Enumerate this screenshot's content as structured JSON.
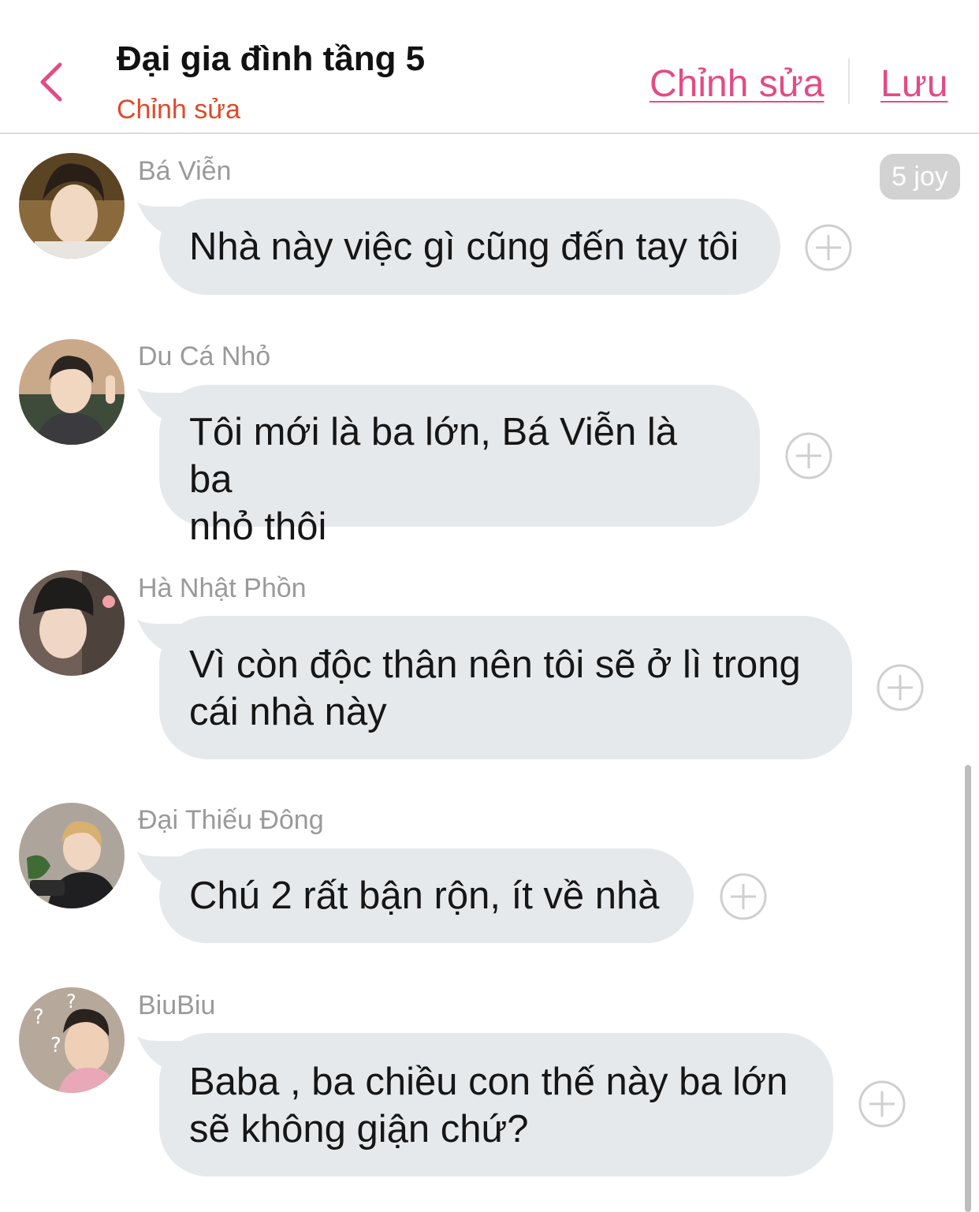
{
  "header": {
    "title": "Đại gia đình tầng 5",
    "subtitle": "Chỉnh sửa",
    "edit_label": "Chỉnh sửa",
    "save_label": "Lưu"
  },
  "badge": "5 joy",
  "messages": [
    {
      "sender": "Bá Viễn",
      "lines": [
        "Nhà này việc gì cũng đến tay tôi"
      ]
    },
    {
      "sender": "Du Cá Nhỏ",
      "lines": [
        "Tôi mới là ba lớn, Bá Viễn là ba",
        "nhỏ thôi"
      ]
    },
    {
      "sender": "Hà Nhật Phồn",
      "lines": [
        "Vì còn độc thân nên tôi sẽ ở lì trong",
        "cái nhà này"
      ]
    },
    {
      "sender": "Đại Thiếu Đông",
      "lines": [
        "Chú 2 rất bận rộn, ít về nhà"
      ]
    },
    {
      "sender": "BiuBiu",
      "lines": [
        "Baba , ba chiều con thế này ba lớn",
        "sẽ không giận chứ?"
      ]
    }
  ],
  "colors": {
    "accent_pink": "#e34b86",
    "subtitle_orange": "#e0492a",
    "bubble_gray": "#e6e9ec"
  },
  "icons": [
    "back-chevron-icon",
    "add-reaction-icon"
  ]
}
